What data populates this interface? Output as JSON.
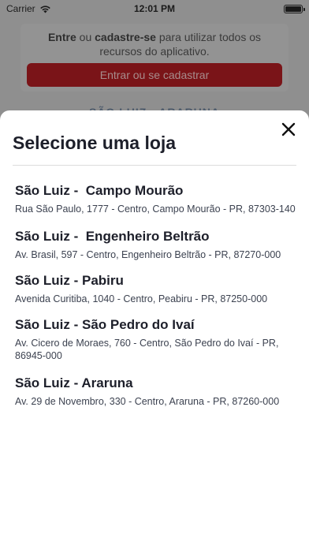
{
  "status_bar": {
    "carrier": "Carrier",
    "time": "12:01 PM"
  },
  "background": {
    "login_prompt": {
      "enter": "Entre",
      "or": " ou ",
      "register": "cadastre-se",
      "rest": " para utilizar todos os recursos do aplicativo."
    },
    "login_button": "Entrar ou se cadastrar",
    "peek_text": "SÃO LUIZ - ARARUNA"
  },
  "modal": {
    "title": "Selecione uma loja",
    "stores": [
      {
        "name": "São Luiz -  Campo Mourão",
        "address": "Rua São Paulo, 1777 - Centro, Campo Mourão - PR, 87303-140"
      },
      {
        "name": "São Luiz -  Engenheiro Beltrão",
        "address": "Av. Brasil, 597 - Centro, Engenheiro Beltrão - PR, 87270-000"
      },
      {
        "name": "São Luiz - Pabiru",
        "address": "Avenida Curitiba, 1040 - Centro, Peabiru - PR, 87250-000"
      },
      {
        "name": "São Luiz - São Pedro do Ivaí",
        "address": "Av. Cicero de Moraes, 760 - Centro, São Pedro do Ivaí - PR, 86945-000"
      },
      {
        "name": "São Luiz - Araruna",
        "address": "Av. 29 de Novembro, 330 - Centro, Araruna - PR, 87260-000"
      }
    ]
  }
}
